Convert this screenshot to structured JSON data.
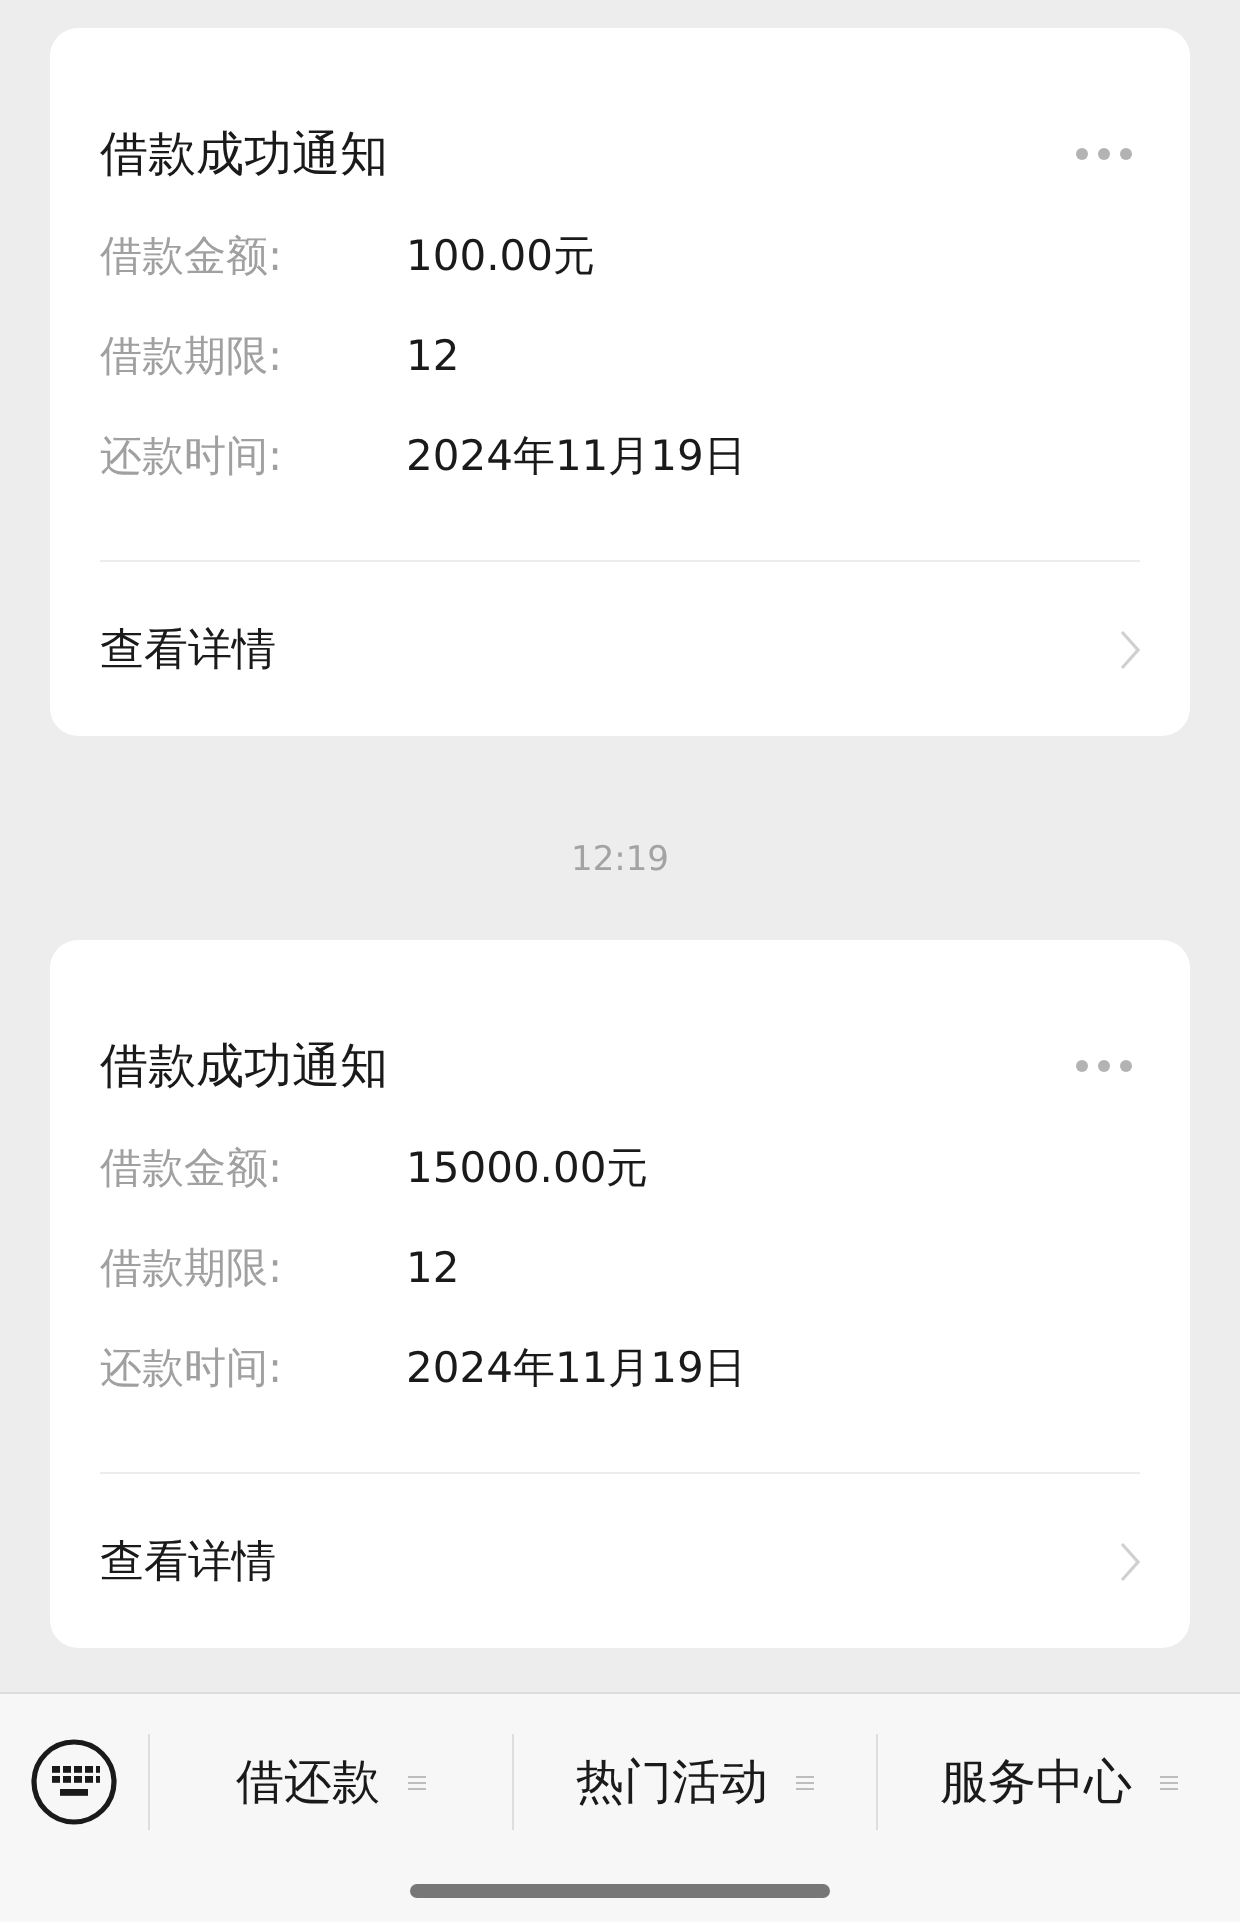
{
  "messages": [
    {
      "card": {
        "title": "借款成功通知",
        "fields": [
          {
            "label": "借款金额:",
            "value": "100.00元"
          },
          {
            "label": "借款期限:",
            "value": "12"
          },
          {
            "label": "还款时间:",
            "value": "2024年11月19日"
          }
        ],
        "link": "查看详情"
      }
    },
    {
      "time": "12:19",
      "card": {
        "title": "借款成功通知",
        "fields": [
          {
            "label": "借款金额:",
            "value": "15000.00元"
          },
          {
            "label": "借款期限:",
            "value": "12"
          },
          {
            "label": "还款时间:",
            "value": "2024年11月19日"
          }
        ],
        "link": "查看详情"
      }
    }
  ],
  "menu_bar": {
    "items": [
      "借还款",
      "热门活动",
      "服务中心"
    ]
  }
}
